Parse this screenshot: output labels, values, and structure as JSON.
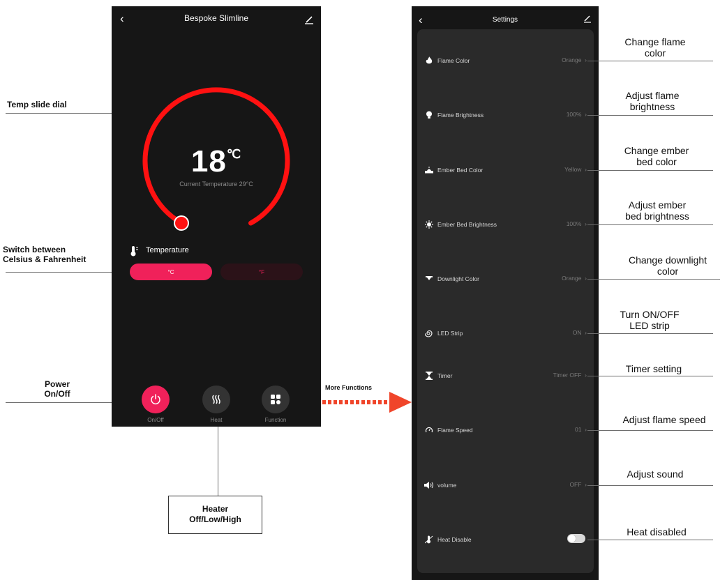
{
  "main_screen": {
    "title": "Bespoke Slimline",
    "temperature": "18",
    "temperature_unit": "℃",
    "current_temperature": "Current Temperature 29°C",
    "dial_progress": 0.58,
    "temperature_section_label": "Temperature",
    "unit_celsius": "°C",
    "unit_fahrenheit": "°F",
    "selected_unit": "°C",
    "controls": [
      {
        "label": "On/Off",
        "icon": "power-icon"
      },
      {
        "label": "Heat",
        "icon": "heat-waves-icon"
      },
      {
        "label": "Function",
        "icon": "grid-icon"
      }
    ]
  },
  "settings_screen": {
    "title": "Settings",
    "rows": [
      {
        "icon": "flame-icon",
        "label": "Flame Color",
        "value": "Orange"
      },
      {
        "icon": "bulb-icon",
        "label": "Flame Brightness",
        "value": "100%"
      },
      {
        "icon": "ember-bed-icon",
        "label": "Ember Bed Color",
        "value": "Yellow"
      },
      {
        "icon": "sun-icon",
        "label": "Ember Bed Brightness",
        "value": "100%"
      },
      {
        "icon": "downlight-icon",
        "label": "Downlight Color",
        "value": "Orange"
      },
      {
        "icon": "spiral-icon",
        "label": "LED Strip",
        "value": "ON"
      },
      {
        "icon": "hourglass-icon",
        "label": "Timer",
        "value": "Timer OFF"
      },
      {
        "icon": "speed-gauge-icon",
        "label": "Flame Speed",
        "value": "01"
      },
      {
        "icon": "speaker-icon",
        "label": "volume",
        "value": "OFF"
      },
      {
        "icon": "heat-disable-icon",
        "label": "Heat Disable",
        "value": ""
      }
    ]
  },
  "annotations": {
    "left": [
      {
        "text": "Temp slide dial"
      },
      {
        "text": "Switch between\nCelsius & Fahrenheit"
      },
      {
        "text": "Power\nOn/Off"
      }
    ],
    "heater": "Heater\nOff/Low/High",
    "more_functions": "More Functions",
    "right": [
      "Change flame\ncolor",
      "Adjust flame\nbrightness",
      "Change ember\nbed color",
      "Adjust ember\nbed brightness",
      "Change downlight\ncolor",
      "Turn ON/OFF\nLED strip",
      "Timer setting",
      "Adjust flame speed",
      "Adjust sound",
      "Heat disabled"
    ]
  },
  "colors": {
    "accent_red": "#ff1111",
    "pink_button": "#f0215a",
    "dark_bg": "#161616",
    "card_bg": "#2a2a2a",
    "arrow_red": "#f0452a"
  }
}
